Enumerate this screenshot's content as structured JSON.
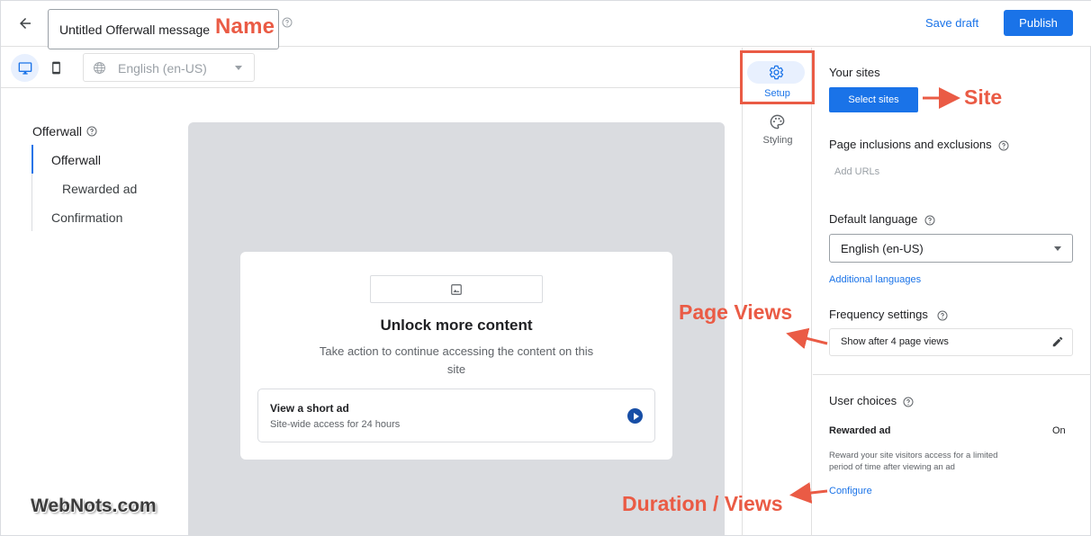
{
  "header": {
    "message_name": "Untitled Offerwall message",
    "save_draft": "Save draft",
    "publish": "Publish"
  },
  "toolbar": {
    "language": "English (en-US)"
  },
  "nav": {
    "title": "Offerwall",
    "items": [
      "Offerwall",
      "Rewarded ad",
      "Confirmation"
    ]
  },
  "preview": {
    "title": "Unlock more content",
    "description": "Take action to continue accessing the content on this site",
    "ad_title": "View a short ad",
    "ad_subtitle": "Site-wide access for 24 hours"
  },
  "tabs": {
    "setup": "Setup",
    "styling": "Styling"
  },
  "panel": {
    "your_sites": "Your sites",
    "select_sites": "Select sites",
    "page_inclusions": "Page inclusions and exclusions",
    "add_urls": "Add URLs",
    "default_language": "Default language",
    "language_value": "English (en-US)",
    "additional_languages": "Additional languages",
    "frequency_settings": "Frequency settings",
    "frequency_value": "Show after 4 page views",
    "user_choices": "User choices",
    "rewarded_ad": "Rewarded ad",
    "rewarded_state": "On",
    "rewarded_desc": "Reward your site visitors access for a limited period of time after viewing an ad",
    "configure": "Configure"
  },
  "annotations": {
    "name": "Name",
    "site": "Site",
    "page_views": "Page Views",
    "duration_views": "Duration / Views"
  },
  "watermark": "WebNots.com",
  "colors": {
    "accent": "#1a73e8",
    "annotation": "#ea5b45",
    "preview_bg": "#dadce0"
  }
}
